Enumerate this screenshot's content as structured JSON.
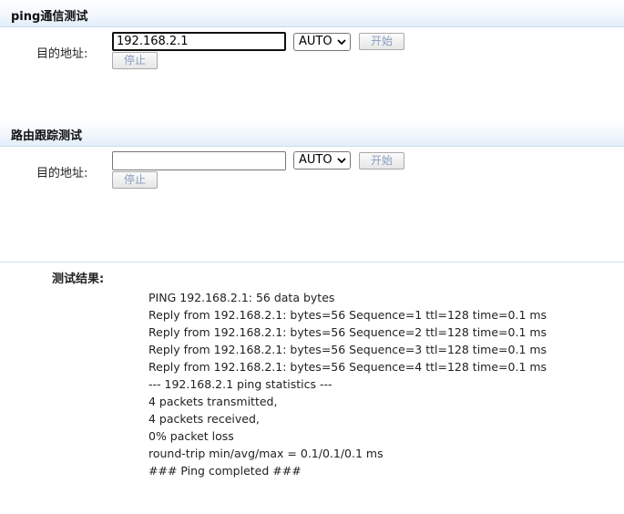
{
  "ping_section": {
    "title": "ping通信测试",
    "address_label": "目的地址:",
    "address_value": "192.168.2.1",
    "mode_value": "AUTO",
    "start_label": "开始",
    "stop_label": "停止"
  },
  "trace_section": {
    "title": "路由跟踪测试",
    "address_label": "目的地址:",
    "address_value": "",
    "mode_value": "AUTO",
    "start_label": "开始",
    "stop_label": "停止"
  },
  "results": {
    "label": "测试结果:",
    "lines": [
      "PING 192.168.2.1: 56 data bytes",
      "Reply from 192.168.2.1: bytes=56 Sequence=1 ttl=128 time=0.1 ms",
      "Reply from 192.168.2.1: bytes=56 Sequence=2 ttl=128 time=0.1 ms",
      "Reply from 192.168.2.1: bytes=56 Sequence=3 ttl=128 time=0.1 ms",
      "Reply from 192.168.2.1: bytes=56 Sequence=4 ttl=128 time=0.1 ms",
      "--- 192.168.2.1 ping statistics ---",
      "4 packets transmitted,",
      "4 packets received,",
      "0% packet loss",
      "round-trip min/avg/max = 0.1/0.1/0.1 ms",
      "### Ping completed ###"
    ]
  },
  "colors": {
    "header_gradient_end": "#e2eefa",
    "disabled_button_text": "#8a9ec2"
  }
}
